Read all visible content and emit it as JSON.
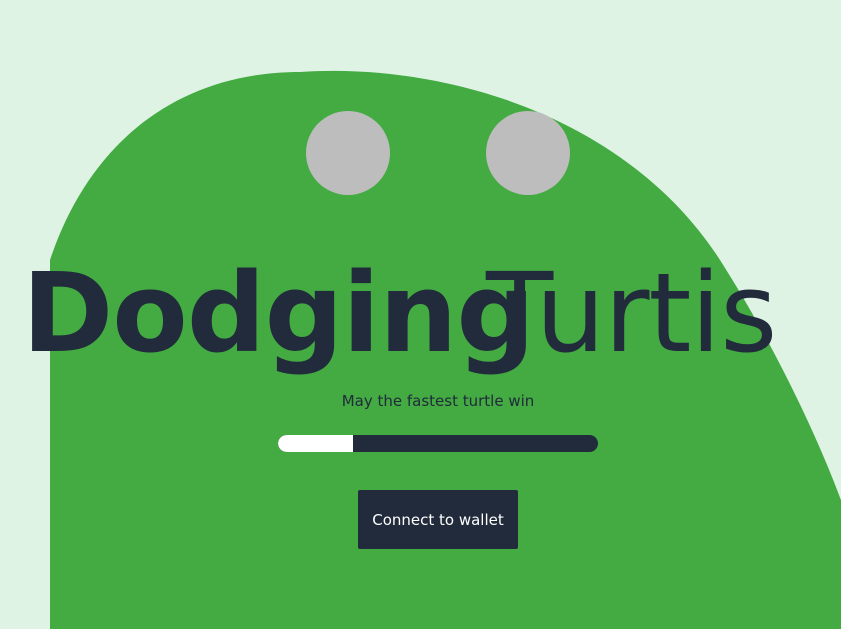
{
  "colors": {
    "background": "#dff3e4",
    "blob": "#43ab42",
    "eye": "#bdbdbd",
    "text_dark": "#212b3b",
    "progress_track": "#212b3b",
    "progress_fill": "#ffffff",
    "button_bg": "#212b3b",
    "button_text": "#ffffff"
  },
  "hero": {
    "title_bold": "Dodging",
    "title_light": "Turtis",
    "subtitle": "May the fastest turtle win"
  },
  "progress": {
    "fraction": 0.235
  },
  "actions": {
    "connect_label": "Connect to wallet"
  }
}
